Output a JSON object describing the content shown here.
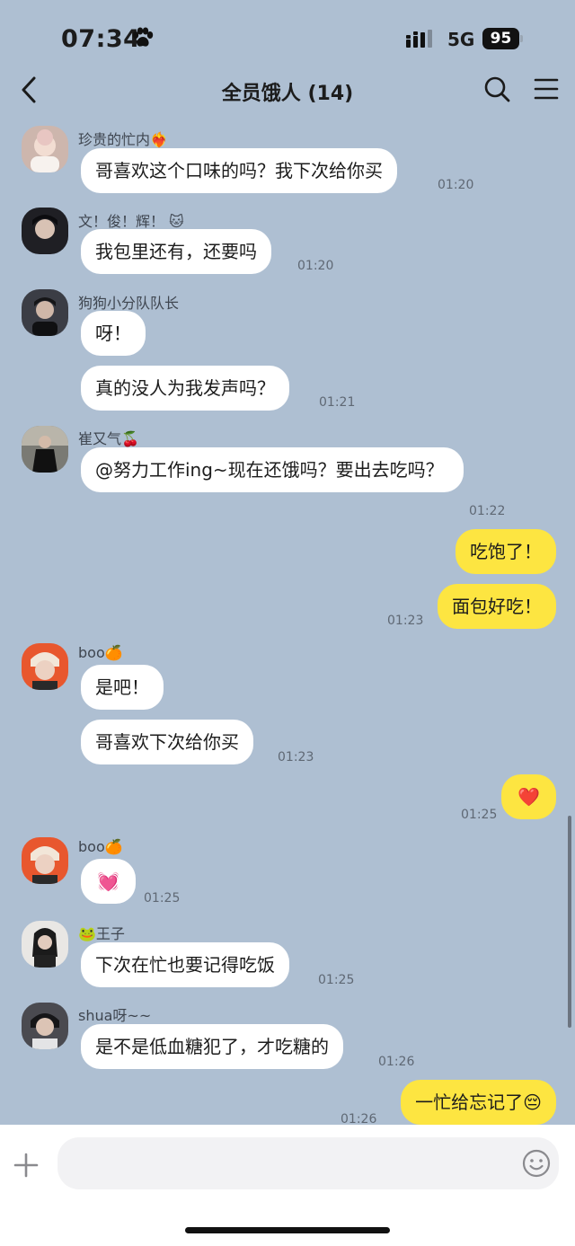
{
  "status_bar": {
    "time": "07:34",
    "network": "5G",
    "battery": "95"
  },
  "header": {
    "title": "全员饿人 (14)"
  },
  "messages": [
    {
      "sender": "珍贵的忙内",
      "text": "哥喜欢这个口味的吗？我下次给你买",
      "time": "01:20"
    },
    {
      "sender": "文！俊！辉！",
      "text": "我包里还有，还要吗",
      "time": "01:20"
    },
    {
      "sender": "狗狗小分队队长",
      "text": "呀！"
    },
    {
      "text": "真的没人为我发声吗？",
      "time": "01:21"
    },
    {
      "sender": "崔又气",
      "text": "@努力工作ing~现在还饿吗？要出去吃吗？",
      "time": "01:22"
    },
    {
      "text": "吃饱了！"
    },
    {
      "text": "面包好吃！",
      "time": "01:23"
    },
    {
      "sender": "boo",
      "text": "是吧！"
    },
    {
      "text": "哥喜欢下次给你买",
      "time": "01:23"
    },
    {
      "text": "❤️",
      "time": "01:25"
    },
    {
      "sender": "boo",
      "text": "💓",
      "time": "01:25"
    },
    {
      "sender": "王子",
      "text": "下次在忙也要记得吃饭",
      "time": "01:25"
    },
    {
      "sender": "shua呀~~",
      "text": "是不是低血糖犯了，才吃糖的",
      "time": "01:26"
    },
    {
      "text": "一忙给忘记了😔",
      "time": "01:26"
    }
  ],
  "input": {
    "placeholder": ""
  }
}
